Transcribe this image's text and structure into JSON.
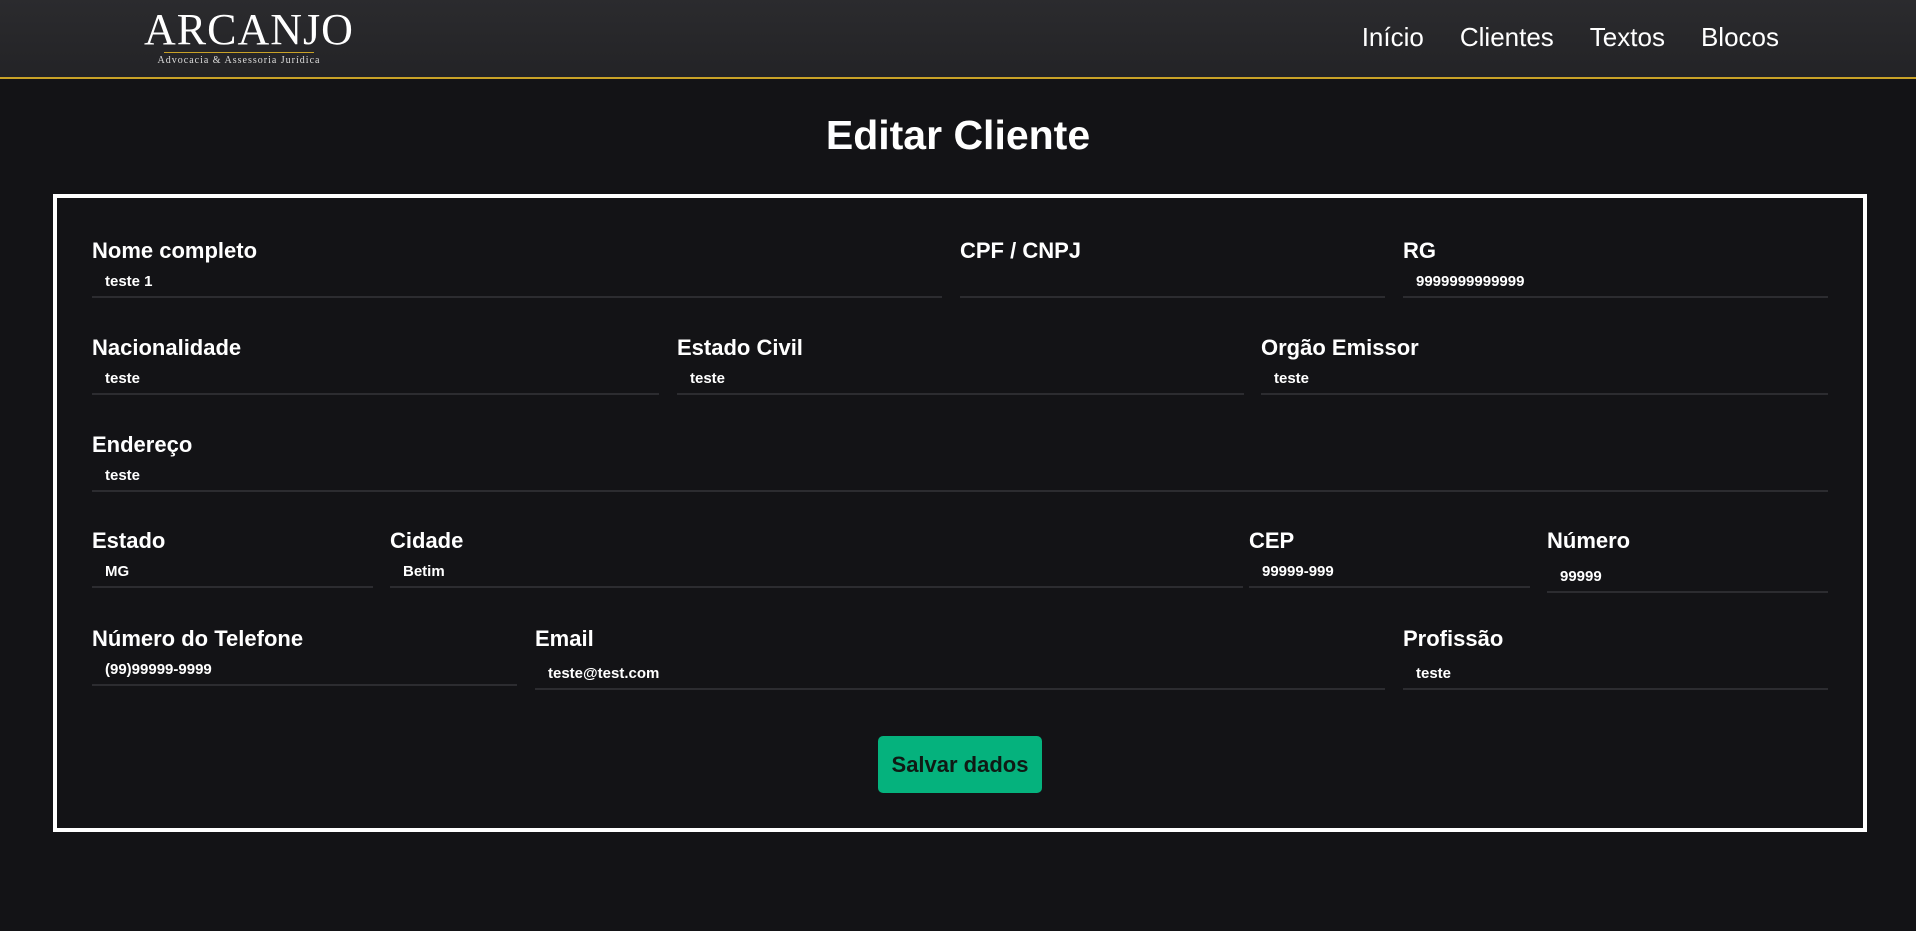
{
  "header": {
    "logo_title": "ARCANJO",
    "logo_subtitle": "Advocacia & Assessoria Jurídica",
    "nav": [
      "Início",
      "Clientes",
      "Textos",
      "Blocos"
    ]
  },
  "page": {
    "title": "Editar Cliente"
  },
  "form": {
    "nome_completo": {
      "label": "Nome completo",
      "value": "teste 1"
    },
    "cpf_cnpj": {
      "label": "CPF / CNPJ",
      "value": ""
    },
    "rg": {
      "label": "RG",
      "value": "9999999999999"
    },
    "nacionalidade": {
      "label": "Nacionalidade",
      "value": "teste"
    },
    "estado_civil": {
      "label": "Estado Civil",
      "value": "teste"
    },
    "orgao_emissor": {
      "label": "Orgão Emissor",
      "value": "teste"
    },
    "endereco": {
      "label": "Endereço",
      "value": "teste"
    },
    "estado": {
      "label": "Estado",
      "value": "MG"
    },
    "cidade": {
      "label": "Cidade",
      "value": "Betim"
    },
    "cep": {
      "label": "CEP",
      "value": "99999-999"
    },
    "numero": {
      "label": "Número",
      "value": "99999"
    },
    "telefone": {
      "label": "Número do Telefone",
      "value": "(99)99999-9999"
    },
    "email": {
      "label": "Email",
      "value": "teste@test.com"
    },
    "profissao": {
      "label": "Profissão",
      "value": "teste"
    },
    "save_label": "Salvar dados"
  },
  "colors": {
    "background": "#131316",
    "navbar": "#2b2b2e",
    "accent_gold": "#c9a227",
    "button_green": "#05b27d"
  }
}
